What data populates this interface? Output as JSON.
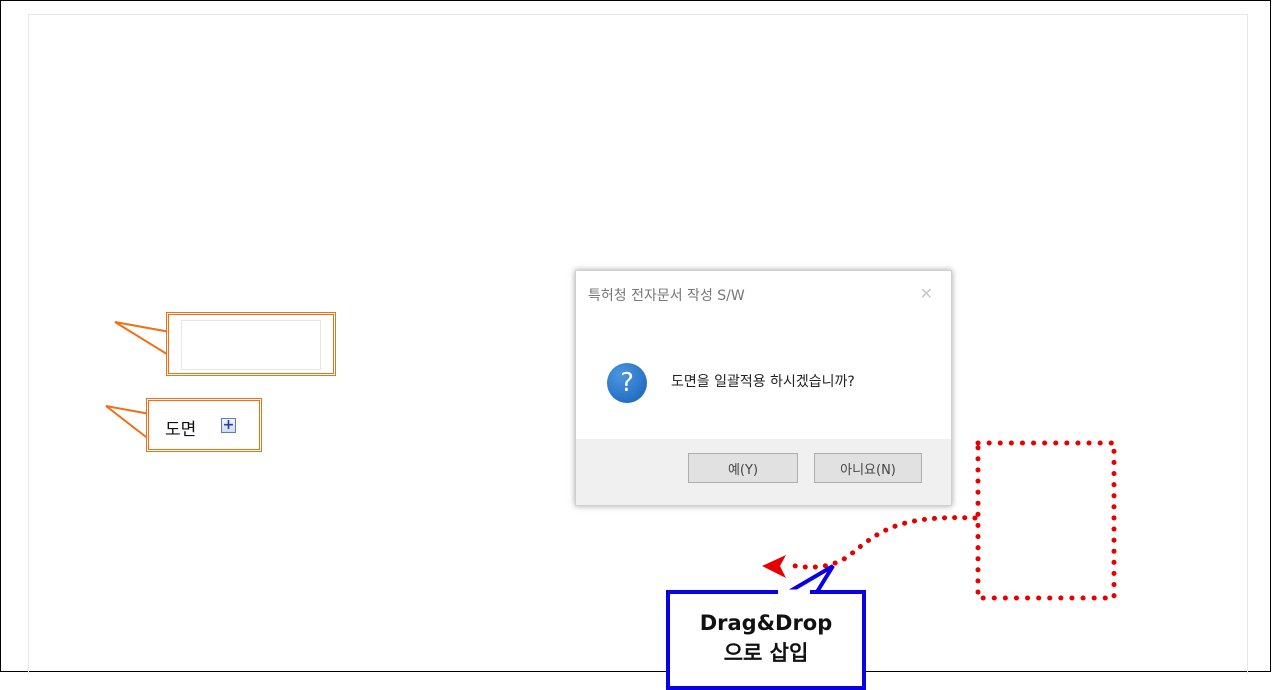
{
  "callouts": {
    "drawing_label": "도면"
  },
  "dialog": {
    "title": "특허청 전자문서 작성 S/W",
    "close_glyph": "✕",
    "message": "도면을 일괄적용 하시겠습니까?",
    "question_glyph": "?",
    "yes_label": "예(Y)",
    "no_label": "아니요(N)"
  },
  "drag_callout": {
    "line1": "Drag&Drop",
    "line2": "으로 삽입"
  },
  "icons": {
    "plus": "+"
  },
  "colors": {
    "orange": "#f07014",
    "blue": "#0a00e6",
    "red_dots": "#e60000"
  }
}
